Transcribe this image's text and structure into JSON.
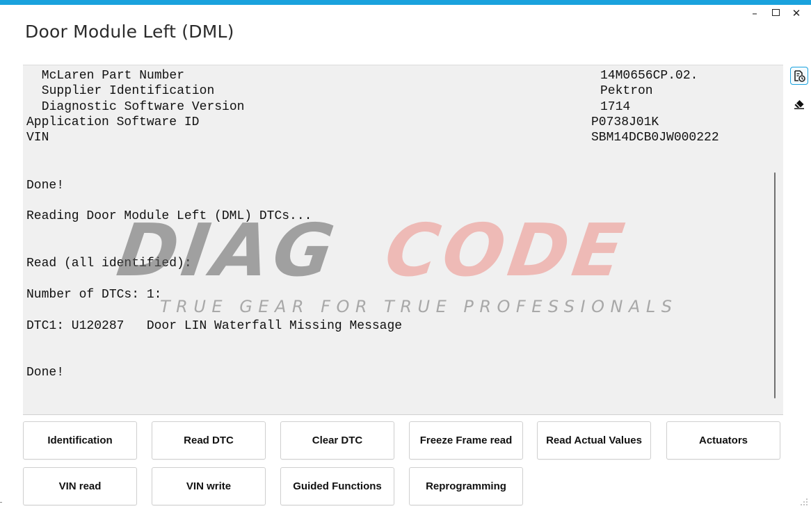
{
  "colors": {
    "accent": "#1aa2dd",
    "pane_background": "#f0f0f0",
    "watermark_gray": "#5f5f5f",
    "watermark_red": "#eb786e"
  },
  "window": {
    "title": "Door Module Left (DML)",
    "minimize_glyph": "–",
    "close_glyph": "✕"
  },
  "output": {
    "lines": [
      " McLaren Part Number",
      "14M0656CP.02.",
      " Supplier Identification",
      "Pektron",
      " Diagnostic Software Version",
      "1714",
      "Application Software ID",
      "P0738J01K",
      "VIN",
      "SBM14DCB0JW000222",
      "Done!",
      "Reading Door Module Left (DML) DTCs...",
      "Read (all identified):",
      "Number of DTCs: 1:",
      "DTC1: U120287   Door LIN Waterfall Missing Message",
      "Done!"
    ]
  },
  "watermark": {
    "logo_part1": "DIAG",
    "logo_part2": "CODE",
    "tagline": "TRUE GEAR FOR TRUE PROFESSIONALS"
  },
  "side_toolbar": {
    "icons": [
      "export-log-icon",
      "eraser-icon"
    ]
  },
  "buttons": [
    {
      "label": "Identification"
    },
    {
      "label": "Read DTC"
    },
    {
      "label": "Clear DTC"
    },
    {
      "label": "Freeze Frame read"
    },
    {
      "label": "Read Actual Values"
    },
    {
      "label": "Actuators"
    },
    {
      "label": "VIN read"
    },
    {
      "label": "VIN write"
    },
    {
      "label": "Guided Functions"
    },
    {
      "label": "Reprogramming"
    }
  ]
}
